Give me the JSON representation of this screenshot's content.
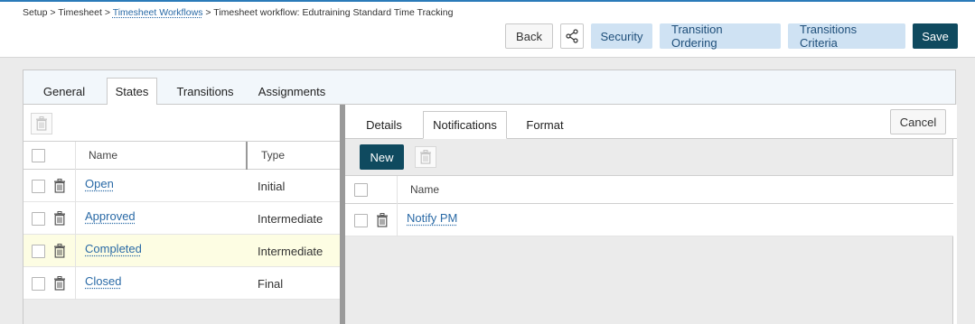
{
  "breadcrumb": {
    "setup": "Setup",
    "timesheet": "Timesheet",
    "workflows": "Timesheet Workflows",
    "current": "Timesheet workflow: Edutraining Standard Time Tracking",
    "sep": ">"
  },
  "toolbar": {
    "back": "Back",
    "security": "Security",
    "transition_ordering": "Transition Ordering",
    "transitions_criteria": "Transitions Criteria",
    "save": "Save"
  },
  "main_tabs": [
    "General",
    "States",
    "Transitions",
    "Assignments"
  ],
  "states_grid": {
    "columns": [
      "Name",
      "Type"
    ],
    "rows": [
      {
        "name": "Open",
        "type": "Initial"
      },
      {
        "name": "Approved",
        "type": "Intermediate"
      },
      {
        "name": "Completed",
        "type": "Intermediate"
      },
      {
        "name": "Closed",
        "type": "Final"
      }
    ]
  },
  "detail_tabs": [
    "Details",
    "Notifications",
    "Format"
  ],
  "cancel": "Cancel",
  "new": "New",
  "notifications_grid": {
    "columns": [
      "Name"
    ],
    "rows": [
      {
        "name": "Notify PM"
      }
    ]
  },
  "colors": {
    "accent": "#2b7bb9",
    "primary_button": "#0f4a5f",
    "secondary_button": "#cfe2f3",
    "link": "#2a6aa6",
    "selected_row": "#fdfde3"
  },
  "icons": {
    "share": "share-icon",
    "delete": "trash-icon"
  }
}
